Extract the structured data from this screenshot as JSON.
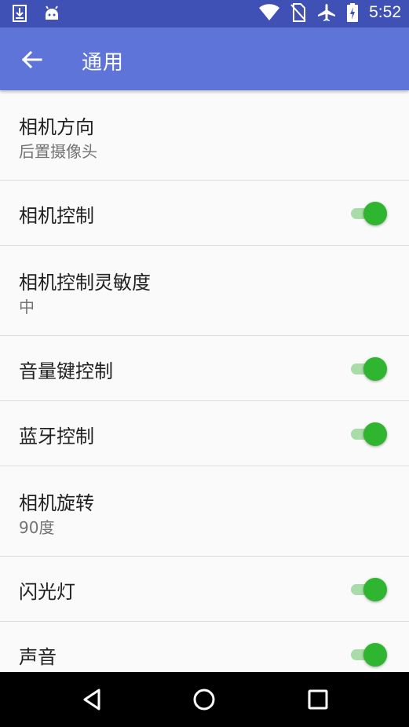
{
  "status_bar": {
    "time": "5:52",
    "icons_left": [
      "download-icon",
      "android-icon"
    ],
    "icons_right": [
      "wifi-icon",
      "no-sim-icon",
      "airplane-icon",
      "battery-icon"
    ]
  },
  "app_bar": {
    "title": "通用",
    "back_icon": "arrow-back-icon",
    "color": "#5f74d9"
  },
  "settings": [
    {
      "key": "camera-direction",
      "title": "相机方向",
      "summary": "后置摄像头"
    },
    {
      "key": "camera-control",
      "title": "相机控制",
      "toggle": true
    },
    {
      "key": "camera-sensitivity",
      "title": "相机控制灵敏度",
      "summary": "中"
    },
    {
      "key": "volume-key-control",
      "title": "音量键控制",
      "toggle": true
    },
    {
      "key": "bluetooth-control",
      "title": "蓝牙控制",
      "toggle": true
    },
    {
      "key": "camera-rotation",
      "title": "相机旋转",
      "summary": "90度"
    },
    {
      "key": "flash",
      "title": "闪光灯",
      "toggle": true
    },
    {
      "key": "sound",
      "title": "声音",
      "toggle": true
    }
  ],
  "colors": {
    "status_bar": "#3f51b5",
    "switch_on": "#2fb52f",
    "switch_track": "#a8dca8"
  },
  "nav_bar": [
    "back-triangle-icon",
    "home-circle-icon",
    "recents-square-icon"
  ]
}
